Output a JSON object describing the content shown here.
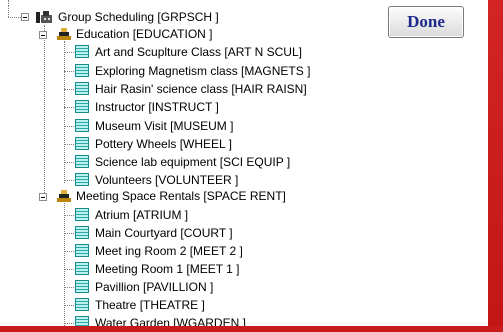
{
  "done_button": {
    "label": "Done"
  },
  "tree": {
    "root": {
      "label": "Group Scheduling [GRPSCH   ]"
    },
    "groups": [
      {
        "label": "Education [EDUCATION ]",
        "items": [
          {
            "label": "Art and Scuplture Class [ART N SCUL]"
          },
          {
            "label": "Exploring Magnetism class [MAGNETS   ]"
          },
          {
            "label": "Hair Rasin' science class [HAIR RAISN]"
          },
          {
            "label": "Instructor [INSTRUCT  ]"
          },
          {
            "label": "Museum Visit [MUSEUM    ]"
          },
          {
            "label": "Pottery Wheels [WHEEL     ]"
          },
          {
            "label": "Science lab equipment [SCI EQUIP ]"
          },
          {
            "label": "Volunteers [VOLUNTEER ]"
          }
        ]
      },
      {
        "label": "Meeting Space Rentals [SPACE RENT]",
        "items": [
          {
            "label": "Atrium [ATRIUM    ]"
          },
          {
            "label": "Main Courtyard [COURT     ]"
          },
          {
            "label": "Meet ing Room 2 [MEET 2    ]"
          },
          {
            "label": "Meeting Room 1 [MEET 1    ]"
          },
          {
            "label": "Pavillion [PAVILLION ]"
          },
          {
            "label": "Theatre [THEATRE   ]"
          },
          {
            "label": "Water Garden [WGARDEN   ]"
          }
        ]
      }
    ]
  },
  "colors": {
    "accent_red": "#c81c1c",
    "done_text": "#1e2a8a",
    "leaf_icon": "#2fa7a7"
  }
}
